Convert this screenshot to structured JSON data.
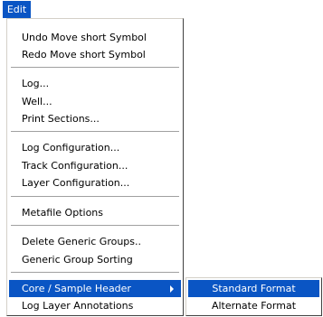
{
  "menubar": {
    "edit_label": "Edit"
  },
  "menu": {
    "items": [
      {
        "label": "Undo Move short Symbol"
      },
      {
        "label": "Redo Move short Symbol"
      },
      {
        "label": "Log..."
      },
      {
        "label": "Well..."
      },
      {
        "label": "Print Sections..."
      },
      {
        "label": "Log Configuration..."
      },
      {
        "label": "Track Configuration..."
      },
      {
        "label": "Layer Configuration..."
      },
      {
        "label": "Metafile Options"
      },
      {
        "label": "Delete Generic Groups.."
      },
      {
        "label": "Generic Group Sorting"
      },
      {
        "label": "Core / Sample Header"
      },
      {
        "label": "Log Layer Annotations"
      }
    ]
  },
  "submenu": {
    "items": [
      {
        "label": "Standard Format"
      },
      {
        "label": "Alternate Format"
      }
    ]
  },
  "colors": {
    "highlight": "#0a55c4"
  }
}
